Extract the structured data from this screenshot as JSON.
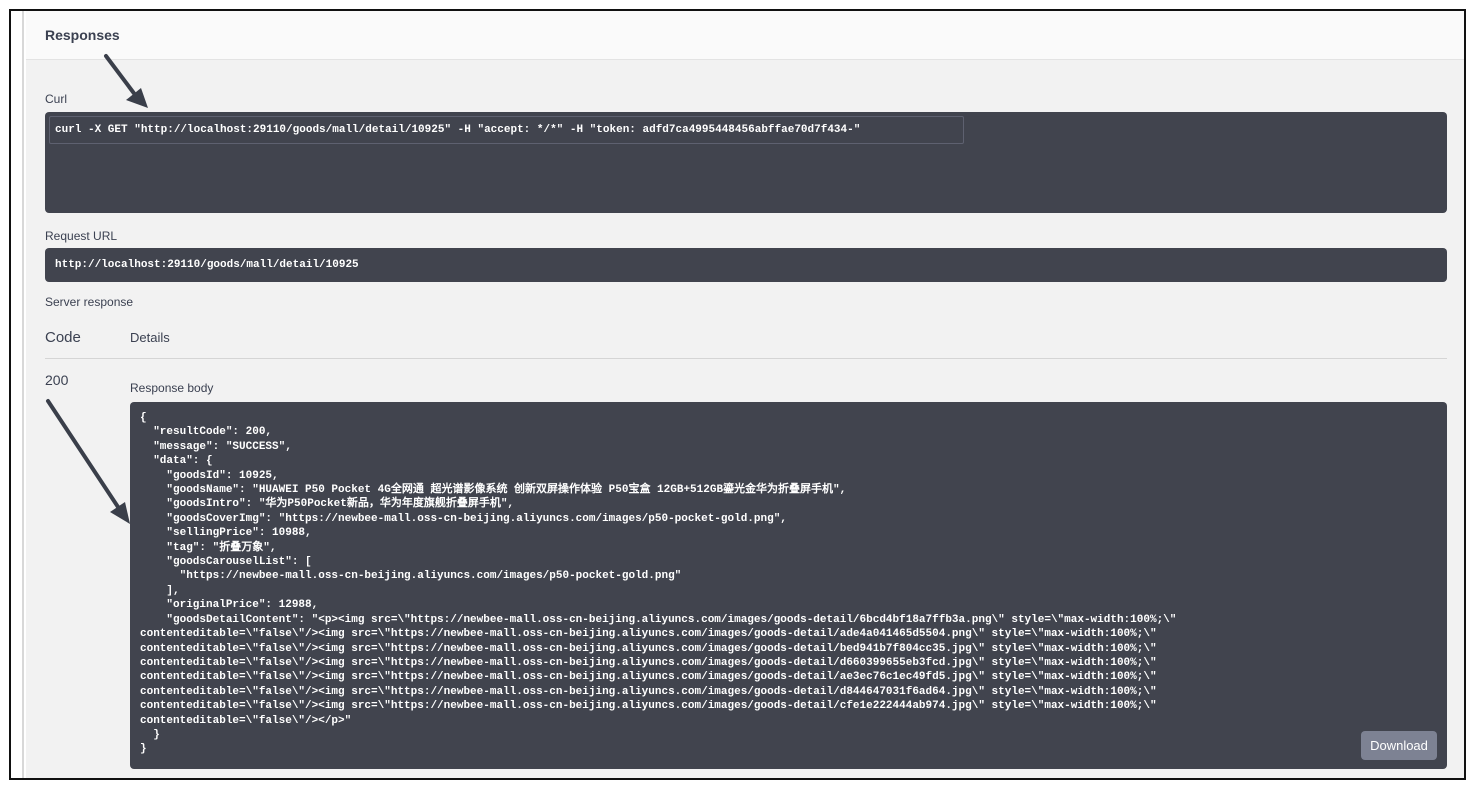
{
  "responses": {
    "title": "Responses",
    "curl_label": "Curl",
    "curl_command": "curl -X GET \"http://localhost:29110/goods/mall/detail/10925\" -H \"accept: */*\" -H \"token: adfd7ca4995448456abffae70d7f434-\"",
    "request_url_label": "Request URL",
    "request_url": "http://localhost:29110/goods/mall/detail/10925",
    "server_response_label": "Server response",
    "code_header": "Code",
    "details_header": "Details",
    "status_code": "200",
    "response_body_label": "Response body",
    "response_body": "{\n  \"resultCode\": 200,\n  \"message\": \"SUCCESS\",\n  \"data\": {\n    \"goodsId\": 10925,\n    \"goodsName\": \"HUAWEI P50 Pocket 4G全网通 超光谱影像系统 创新双屏操作体验 P50宝盒 12GB+512GB鎏光金华为折叠屏手机\",\n    \"goodsIntro\": \"华为P50Pocket新品，华为年度旗舰折叠屏手机\",\n    \"goodsCoverImg\": \"https://newbee-mall.oss-cn-beijing.aliyuncs.com/images/p50-pocket-gold.png\",\n    \"sellingPrice\": 10988,\n    \"tag\": \"折叠万象\",\n    \"goodsCarouselList\": [\n      \"https://newbee-mall.oss-cn-beijing.aliyuncs.com/images/p50-pocket-gold.png\"\n    ],\n    \"originalPrice\": 12988,\n    \"goodsDetailContent\": \"<p><img src=\\\"https://newbee-mall.oss-cn-beijing.aliyuncs.com/images/goods-detail/6bcd4bf18a7ffb3a.png\\\" style=\\\"max-width:100%;\\\" \ncontenteditable=\\\"false\\\"/><img src=\\\"https://newbee-mall.oss-cn-beijing.aliyuncs.com/images/goods-detail/ade4a041465d5504.png\\\" style=\\\"max-width:100%;\\\" \ncontenteditable=\\\"false\\\"/><img src=\\\"https://newbee-mall.oss-cn-beijing.aliyuncs.com/images/goods-detail/bed941b7f804cc35.jpg\\\" style=\\\"max-width:100%;\\\" \ncontenteditable=\\\"false\\\"/><img src=\\\"https://newbee-mall.oss-cn-beijing.aliyuncs.com/images/goods-detail/d660399655eb3fcd.jpg\\\" style=\\\"max-width:100%;\\\" \ncontenteditable=\\\"false\\\"/><img src=\\\"https://newbee-mall.oss-cn-beijing.aliyuncs.com/images/goods-detail/ae3ec76c1ec49fd5.jpg\\\" style=\\\"max-width:100%;\\\" \ncontenteditable=\\\"false\\\"/><img src=\\\"https://newbee-mall.oss-cn-beijing.aliyuncs.com/images/goods-detail/d844647031f6ad64.jpg\\\" style=\\\"max-width:100%;\\\" \ncontenteditable=\\\"false\\\"/><img src=\\\"https://newbee-mall.oss-cn-beijing.aliyuncs.com/images/goods-detail/cfe1e222444ab974.jpg\\\" style=\\\"max-width:100%;\\\" \ncontenteditable=\\\"false\\\"/></p>\"\n  }\n}",
    "download_label": "Download"
  },
  "colors": {
    "code_background": "#41444e",
    "panel_background": "#f2f2f2",
    "download_button": "#7d8293",
    "arrow": "#3a3f4a"
  }
}
